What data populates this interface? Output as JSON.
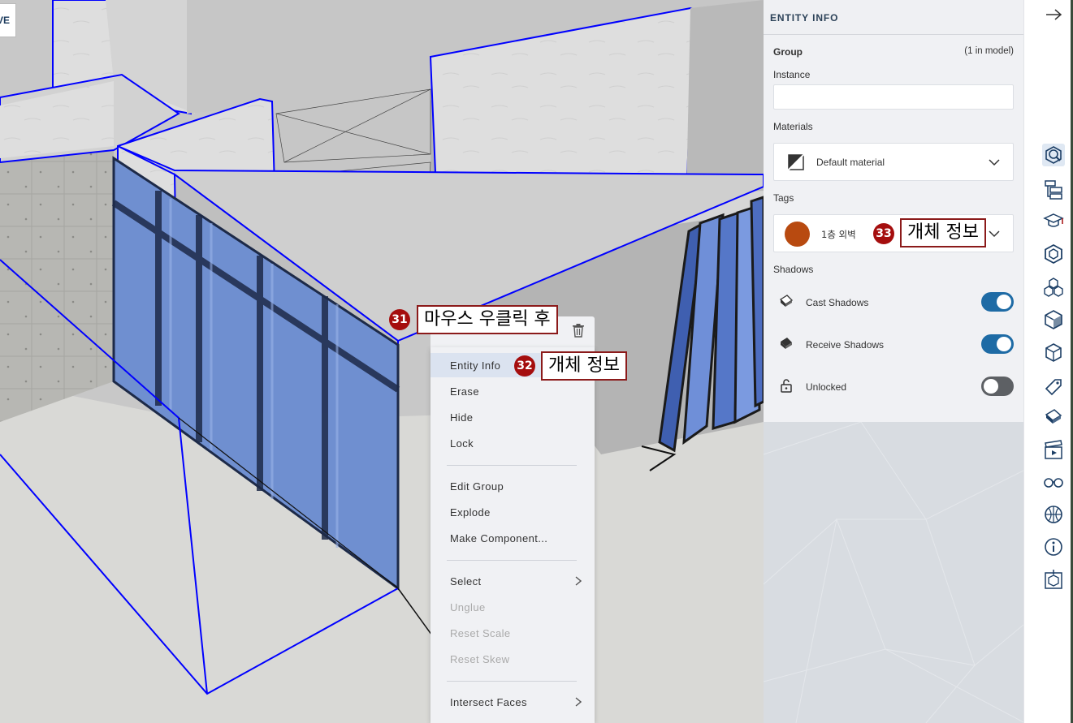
{
  "viewport": {
    "perspective_tab": "VE"
  },
  "callouts": [
    {
      "number": "31",
      "text": "마우스 우클릭 후"
    },
    {
      "number": "32",
      "text": "개체 정보"
    },
    {
      "number": "33",
      "text": "개체 정보"
    }
  ],
  "context_menu": {
    "items": [
      {
        "label": "Entity Info",
        "state": "highlighted"
      },
      {
        "label": "Erase"
      },
      {
        "label": "Hide"
      },
      {
        "label": "Lock"
      },
      {
        "label": "Edit Group"
      },
      {
        "label": "Explode"
      },
      {
        "label": "Make Component..."
      },
      {
        "label": "Select",
        "submenu": true
      },
      {
        "label": "Unglue",
        "state": "disabled"
      },
      {
        "label": "Reset Scale",
        "state": "disabled"
      },
      {
        "label": "Reset Skew",
        "state": "disabled"
      },
      {
        "label": "Intersect Faces",
        "submenu": true
      }
    ]
  },
  "entity_info": {
    "title": "ENTITY INFO",
    "type": "Group",
    "count": "(1 in model)",
    "instance_label": "Instance",
    "instance_value": "",
    "materials_label": "Materials",
    "material_value": "Default material",
    "tags_label": "Tags",
    "tag_value": "1층 외벽",
    "tag_color": "#b84a10",
    "shadows_label": "Shadows",
    "cast_shadows": {
      "label": "Cast Shadows",
      "on": true
    },
    "receive_shadows": {
      "label": "Receive Shadows",
      "on": true
    },
    "unlocked": {
      "label": "Unlocked",
      "on": false
    }
  },
  "right_toolbar": {
    "icons": [
      "entity-info-icon",
      "outliner-icon",
      "instructor-icon",
      "components-icon",
      "materials-icon",
      "styles-icon",
      "model-info-icon",
      "tags-icon",
      "shadows-icon",
      "scenes-icon",
      "soften-edges-icon",
      "display-icon",
      "info-icon",
      "export-icon"
    ],
    "active": "entity-info-icon",
    "collapse_icon": "arrow-right-icon"
  },
  "colors": {
    "accent": "#1e6ba5",
    "selection_blue": "#0000ff",
    "callout_red": "#a50e0e"
  }
}
